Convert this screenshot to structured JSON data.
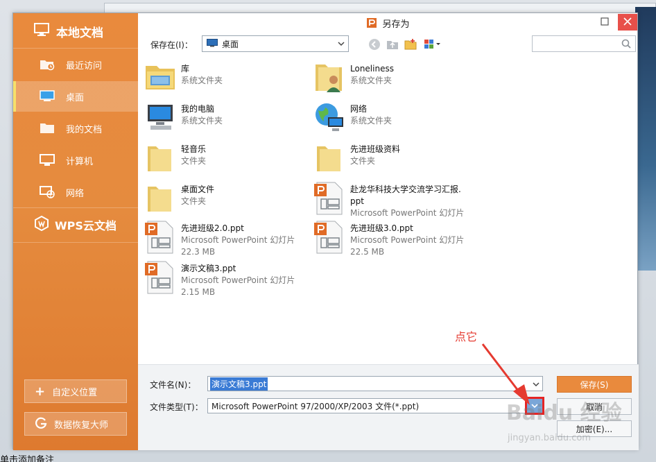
{
  "sidebar": {
    "header": "本地文档",
    "items": [
      {
        "label": "最近访问",
        "icon": "clock-folder-icon"
      },
      {
        "label": "桌面",
        "icon": "desktop-icon"
      },
      {
        "label": "我的文档",
        "icon": "folder-icon"
      },
      {
        "label": "计算机",
        "icon": "computer-icon"
      },
      {
        "label": "网络",
        "icon": "network-icon"
      }
    ],
    "active_index": 1,
    "cloud": "WPS云文档",
    "custom_location": "自定义位置",
    "recovery": "数据恢复大师"
  },
  "dialog": {
    "title": "另存为"
  },
  "toolbar": {
    "save_in_label": "保存在(I)：",
    "location": "桌面"
  },
  "files": [
    {
      "name": "库",
      "sub": "系统文件夹",
      "sub2": "",
      "icon": "library-icon"
    },
    {
      "name": "Loneliness",
      "sub": "系统文件夹",
      "sub2": "",
      "icon": "user-folder-icon"
    },
    {
      "name": "我的电脑",
      "sub": "系统文件夹",
      "sub2": "",
      "icon": "computer-icon"
    },
    {
      "name": "网络",
      "sub": "系统文件夹",
      "sub2": "",
      "icon": "network-globe-icon"
    },
    {
      "name": "轻音乐",
      "sub": "文件夹",
      "sub2": "",
      "icon": "folder-icon"
    },
    {
      "name": "先进班级资料",
      "sub": "文件夹",
      "sub2": "",
      "icon": "folder-icon"
    },
    {
      "name": "桌面文件",
      "sub": "文件夹",
      "sub2": "",
      "icon": "folder-icon"
    },
    {
      "name": "赴龙华科技大学交流学习汇报.",
      "name2": "ppt",
      "sub": "Microsoft PowerPoint 幻灯片",
      "sub2": "",
      "icon": "ppt-file-icon"
    },
    {
      "name": "先进班级2.0.ppt",
      "sub": "Microsoft PowerPoint 幻灯片",
      "sub2": "22.3 MB",
      "icon": "ppt-file-icon"
    },
    {
      "name": "先进班级3.0.ppt",
      "sub": "Microsoft PowerPoint 幻灯片",
      "sub2": "22.5 MB",
      "icon": "ppt-file-icon"
    },
    {
      "name": "演示文稿3.ppt",
      "sub": "Microsoft PowerPoint 幻灯片",
      "sub2": "2.15 MB",
      "icon": "ppt-file-icon"
    }
  ],
  "form": {
    "filename_label": "文件名(N)：",
    "filename_value": "演示文稿3.ppt",
    "filetype_label": "文件类型(T)：",
    "filetype_value": "Microsoft PowerPoint 97/2000/XP/2003 文件(*.ppt)"
  },
  "buttons": {
    "save": "保存(S)",
    "cancel": "取消",
    "encrypt": "加密(E)..."
  },
  "annotation": {
    "text": "点它"
  },
  "watermark": {
    "main": "Baidu 经验",
    "sub": "jingyan.baidu.com"
  },
  "background_text": "单击添加备注",
  "colors": {
    "accent": "#e98a3d",
    "close": "#e8504a",
    "annotation": "#e53a30"
  }
}
